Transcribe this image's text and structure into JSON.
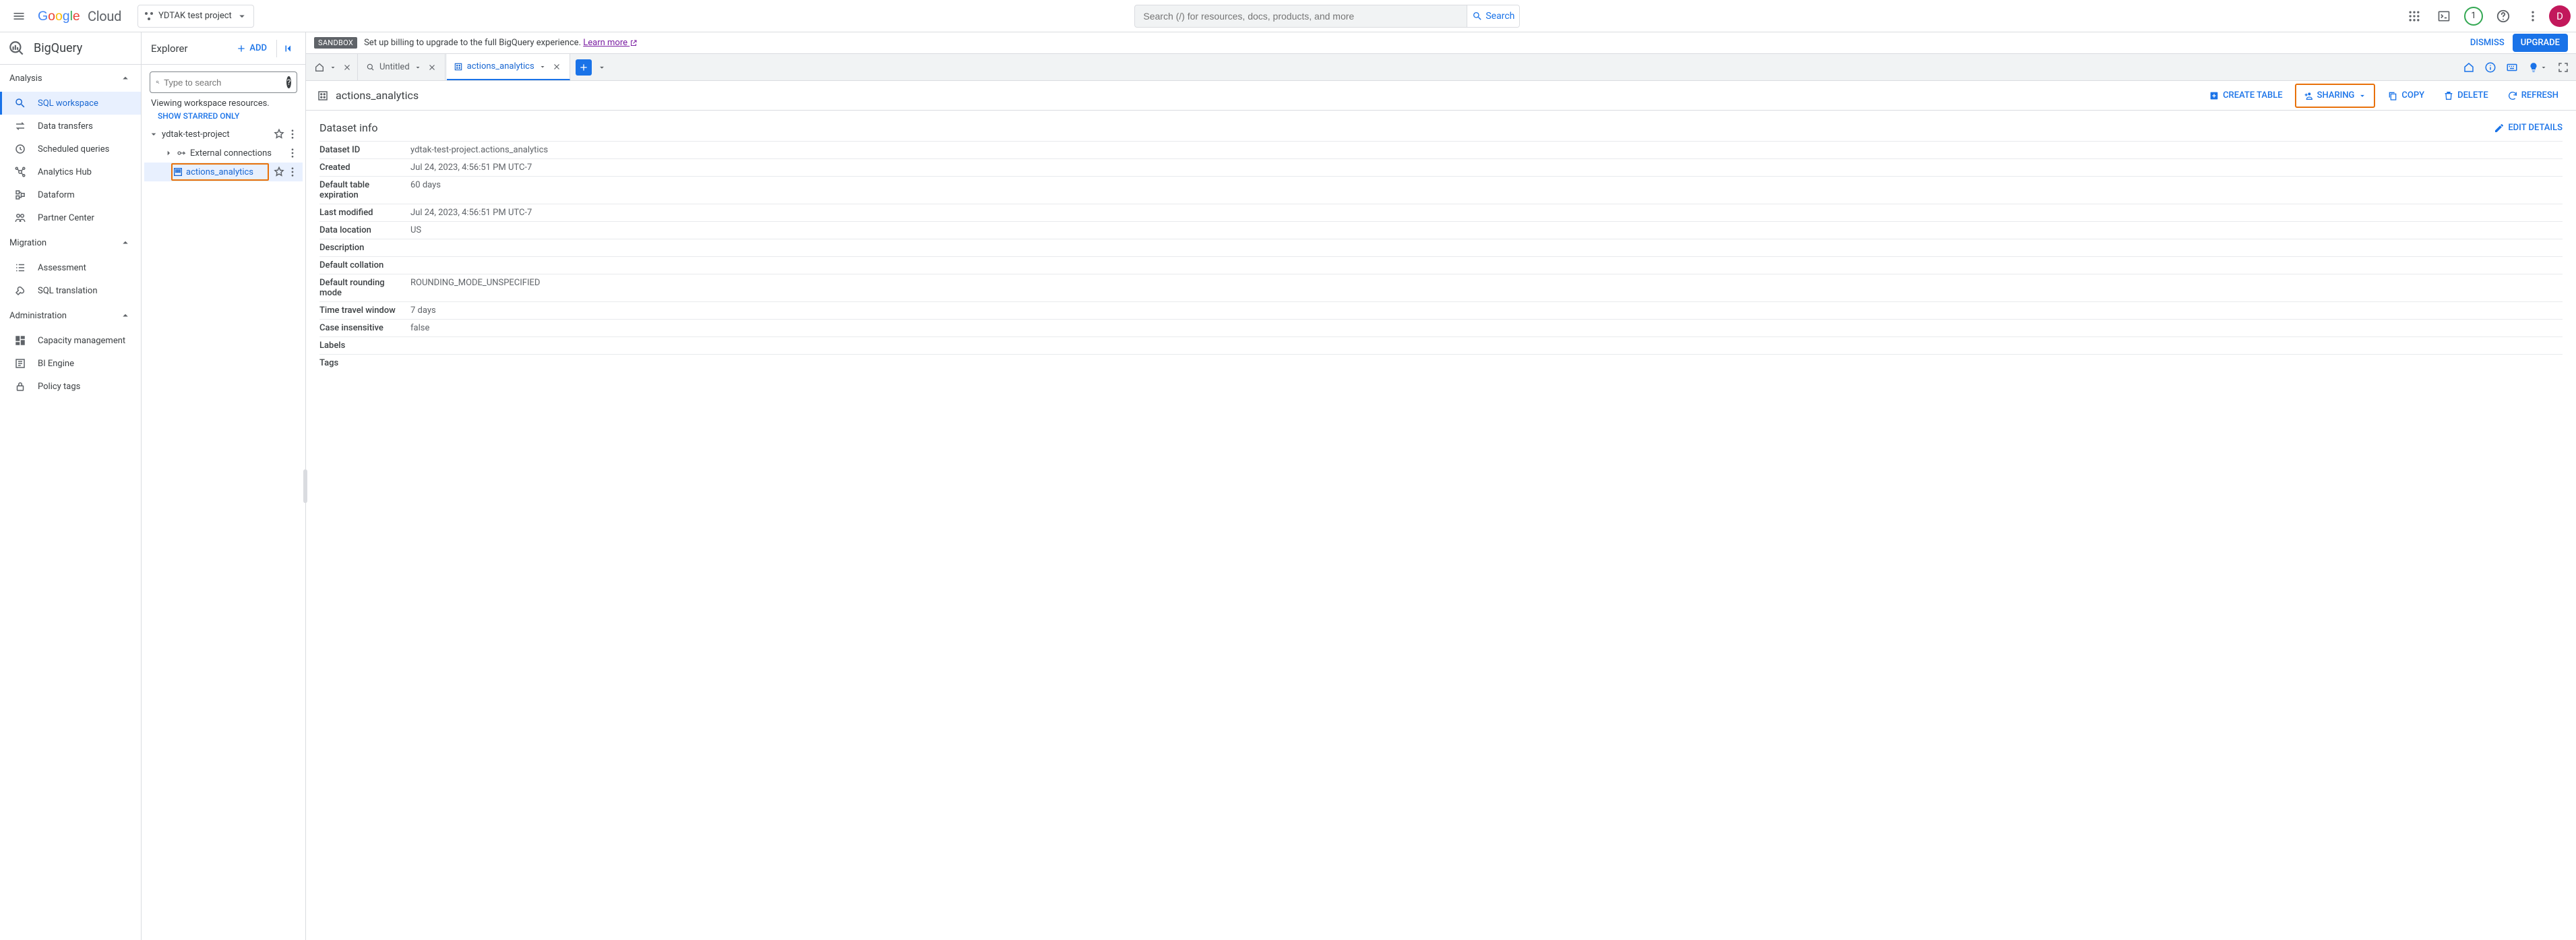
{
  "header": {
    "brand": "Google Cloud",
    "project_name": "YDTAK test project",
    "search_placeholder": "Search (/) for resources, docs, products, and more",
    "search_button": "Search",
    "trial_count": "1",
    "avatar_initial": "D"
  },
  "product": {
    "title": "BigQuery"
  },
  "nav": {
    "analysis": {
      "label": "Analysis",
      "items": [
        {
          "label": "SQL workspace"
        },
        {
          "label": "Data transfers"
        },
        {
          "label": "Scheduled queries"
        },
        {
          "label": "Analytics Hub"
        },
        {
          "label": "Dataform"
        },
        {
          "label": "Partner Center"
        }
      ]
    },
    "migration": {
      "label": "Migration",
      "items": [
        {
          "label": "Assessment"
        },
        {
          "label": "SQL translation"
        }
      ]
    },
    "administration": {
      "label": "Administration",
      "items": [
        {
          "label": "Capacity management"
        },
        {
          "label": "BI Engine"
        },
        {
          "label": "Policy tags"
        }
      ]
    }
  },
  "explorer": {
    "title": "Explorer",
    "add_label": "ADD",
    "search_placeholder": "Type to search",
    "viewing_text": "Viewing workspace resources.",
    "show_starred": "SHOW STARRED ONLY",
    "project": "ydtak-test-project",
    "external_conn": "External connections",
    "dataset": "actions_analytics"
  },
  "notice": {
    "chip": "SANDBOX",
    "text": "Set up billing to upgrade to the full BigQuery experience. ",
    "learn_more": "Learn more",
    "dismiss": "DISMISS",
    "upgrade": "UPGRADE"
  },
  "tabs": {
    "untitled": "Untitled",
    "active": "actions_analytics"
  },
  "dataset": {
    "title": "actions_analytics",
    "actions": {
      "create_table": "CREATE TABLE",
      "sharing": "SHARING",
      "copy": "COPY",
      "delete": "DELETE",
      "refresh": "REFRESH"
    },
    "info_title": "Dataset info",
    "edit_details": "EDIT DETAILS",
    "rows": [
      {
        "k": "Dataset ID",
        "v": "ydtak-test-project.actions_analytics"
      },
      {
        "k": "Created",
        "v": "Jul 24, 2023, 4:56:51 PM UTC-7"
      },
      {
        "k": "Default table expiration",
        "v": "60 days"
      },
      {
        "k": "Last modified",
        "v": "Jul 24, 2023, 4:56:51 PM UTC-7"
      },
      {
        "k": "Data location",
        "v": "US"
      },
      {
        "k": "Description",
        "v": ""
      },
      {
        "k": "Default collation",
        "v": ""
      },
      {
        "k": "Default rounding mode",
        "v": "ROUNDING_MODE_UNSPECIFIED"
      },
      {
        "k": "Time travel window",
        "v": "7 days"
      },
      {
        "k": "Case insensitive",
        "v": "false"
      },
      {
        "k": "Labels",
        "v": ""
      },
      {
        "k": "Tags",
        "v": ""
      }
    ]
  }
}
